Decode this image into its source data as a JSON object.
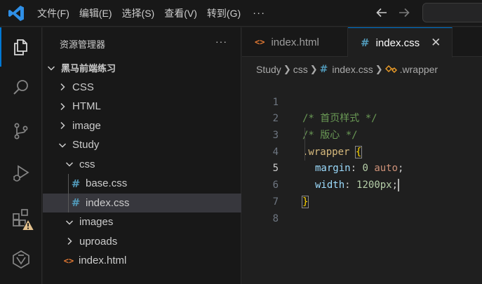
{
  "menu": {
    "items": [
      "文件(F)",
      "编辑(E)",
      "选择(S)",
      "查看(V)",
      "转到(G)"
    ],
    "more": "···"
  },
  "activity": {
    "icons": [
      "explorer-icon",
      "search-icon",
      "source-control-icon",
      "run-debug-icon",
      "extensions-icon",
      "remote-icon"
    ],
    "accent": "#0078d4",
    "warning_color": "#e2c08d"
  },
  "sidebar": {
    "title": "资源管理器",
    "more": "···",
    "root": "黑马前端练习",
    "items": [
      {
        "label": "CSS",
        "type": "folder",
        "expanded": false,
        "depth": 1
      },
      {
        "label": "HTML",
        "type": "folder",
        "expanded": false,
        "depth": 1
      },
      {
        "label": "image",
        "type": "folder",
        "expanded": false,
        "depth": 1
      },
      {
        "label": "Study",
        "type": "folder",
        "expanded": true,
        "depth": 1
      },
      {
        "label": "css",
        "type": "folder",
        "expanded": true,
        "depth": 2
      },
      {
        "label": "base.css",
        "type": "css",
        "depth": 3
      },
      {
        "label": "index.css",
        "type": "css",
        "depth": 3,
        "selected": true
      },
      {
        "label": "images",
        "type": "folder",
        "expanded": true,
        "depth": 2
      },
      {
        "label": "uproads",
        "type": "folder",
        "expanded": false,
        "depth": 2
      },
      {
        "label": "index.html",
        "type": "html",
        "depth": 2
      }
    ]
  },
  "tabs": [
    {
      "label": "index.html",
      "icon": "html-file-icon",
      "active": false
    },
    {
      "label": "index.css",
      "icon": "css-file-icon",
      "active": true,
      "close": "✕"
    }
  ],
  "breadcrumb": {
    "items": [
      "Study",
      "css",
      "index.css",
      ".wrapper"
    ]
  },
  "code": {
    "line_numbers": [
      "1",
      "2",
      "3",
      "4",
      "5",
      "6",
      "7",
      "8"
    ],
    "current_line": "5",
    "lines": {
      "l1": "/* 首页样式 */",
      "l2": "/* 版心 */",
      "l3_selector": ".wrapper",
      "l3_brace": "{",
      "l4_prop": "margin",
      "l4_colon": ":",
      "l4_num": "0",
      "l4_kw": "auto",
      "l4_semi": ";",
      "l5_prop": "width",
      "l5_colon": ":",
      "l5_num": "1200px",
      "l5_semi": ";",
      "l6_brace": "}"
    }
  }
}
